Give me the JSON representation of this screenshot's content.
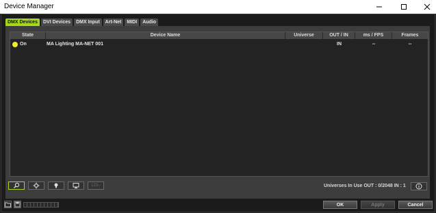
{
  "window": {
    "title": "Device Manager",
    "controls": {
      "minimize_icon": "minimize-icon",
      "maximize_icon": "maximize-icon",
      "close_icon": "close-icon"
    }
  },
  "tabs": [
    {
      "label": "DMX Devices",
      "active": true
    },
    {
      "label": "DVI Devices",
      "active": false
    },
    {
      "label": "DMX Input",
      "active": false
    },
    {
      "label": "Art-Net",
      "active": false
    },
    {
      "label": "MIDI",
      "active": false
    },
    {
      "label": "Audio",
      "active": false
    }
  ],
  "table": {
    "columns": [
      "State",
      "Device Name",
      "Universe",
      "OUT / IN",
      "ms / FPS",
      "Frames"
    ],
    "rows": [
      {
        "status_color": "#f2ea28",
        "state": "On",
        "device_name": "MA Lighting MA-NET 001",
        "universe": "",
        "out_in": "IN",
        "ms_fps": "--",
        "frames": "--"
      }
    ]
  },
  "toolbar": {
    "buttons": [
      {
        "icon": "search-icon",
        "active": true
      },
      {
        "icon": "gear-icon",
        "active": false
      },
      {
        "icon": "lightbulb-icon",
        "active": false
      },
      {
        "icon": "monitor-icon",
        "active": false
      },
      {
        "icon": "numbers-icon",
        "label": "123--",
        "disabled": true
      }
    ],
    "universes_text": "Universes In Use OUT : 0/2048  IN : 1",
    "info_icon": "info-icon"
  },
  "footer": {
    "ok_label": "OK",
    "apply_label": "Apply",
    "cancel_label": "Cancel"
  },
  "colors": {
    "accent": "#a6d81a",
    "status_on": "#f2ea28"
  }
}
